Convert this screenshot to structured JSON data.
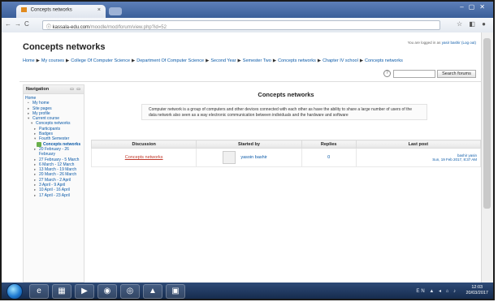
{
  "browser": {
    "tab_title": "Concepts networks",
    "tab_close": "×",
    "url_host": "kassala-edu.com",
    "url_path": "/moodle/mod/forum/view.php?id=52"
  },
  "site": {
    "title": "Concepts networks",
    "login_prefix": "You are logged in as",
    "login_user": "yasir bashir",
    "login_suffix": "(Log out)"
  },
  "breadcrumb": [
    "Home",
    "My courses",
    "College Of Computer Science",
    "Department Of Computer Science",
    "Second Year",
    "Semester Two",
    "Concepts networks",
    "Chapter IV school",
    "Concepts networks"
  ],
  "search": {
    "button_label": "Search forums",
    "help_glyph": "?"
  },
  "navigation": {
    "title": "Navigation",
    "items": [
      {
        "label": "Home",
        "level": 0
      },
      {
        "label": "My home",
        "level": 1,
        "arrow": "•"
      },
      {
        "label": "Site pages",
        "level": 1,
        "arrow": "▸"
      },
      {
        "label": "My profile",
        "level": 1,
        "arrow": "▸"
      },
      {
        "label": "Current course",
        "level": 1,
        "arrow": "▾"
      },
      {
        "label": "Concepts networks",
        "level": 2,
        "arrow": "▾"
      },
      {
        "label": "Participants",
        "level": 3,
        "arrow": "▸"
      },
      {
        "label": "Badges",
        "level": 3,
        "arrow": "▸"
      },
      {
        "label": "Fourth Semester",
        "level": 3,
        "arrow": "▾"
      },
      {
        "label": "Concepts networks",
        "level": 4,
        "active": true
      },
      {
        "label": "20 February - 26 February",
        "level": 3,
        "arrow": "▸"
      },
      {
        "label": "27 February - 5 March",
        "level": 3,
        "arrow": "▸"
      },
      {
        "label": "6 March - 12 March",
        "level": 3,
        "arrow": "▸"
      },
      {
        "label": "13 March - 19 March",
        "level": 3,
        "arrow": "▸"
      },
      {
        "label": "20 March - 26 March",
        "level": 3,
        "arrow": "▸"
      },
      {
        "label": "27 March - 2 April",
        "level": 3,
        "arrow": "▸"
      },
      {
        "label": "3 April - 9 April",
        "level": 3,
        "arrow": "▸"
      },
      {
        "label": "10 April - 16 April",
        "level": 3,
        "arrow": "▸"
      },
      {
        "label": "17 April - 23 April",
        "level": 3,
        "arrow": "▸"
      }
    ]
  },
  "forum": {
    "title": "Concepts networks",
    "intro": "Computer network is a group of computers and other devices connected with each other as have the ability to share a large number of users of the data network also seen as a way electronic communication between individuals and the hardware and software",
    "columns": [
      "Discussion",
      "Started by",
      "Replies",
      "Last post"
    ],
    "rows": [
      {
        "discussion": "Concepts networks",
        "started_by": "yasoin bashir",
        "replies": "0",
        "last_post_user": "bashir yasin",
        "last_post_date": "Sun, 19 Feb 2017, 8:37 AM"
      }
    ]
  },
  "taskbar": {
    "clock_time": "12:03",
    "clock_date": "20/03/2017",
    "tray": "EN ▲ ◂ ⌂ ♪",
    "apps": [
      "e",
      "▦",
      "▶",
      "◉",
      "◎",
      "▲",
      "▣"
    ]
  },
  "colors": {
    "link": "#0b5aa8",
    "discussion_link": "#c0392b",
    "taskbar": "#1f3a63"
  }
}
